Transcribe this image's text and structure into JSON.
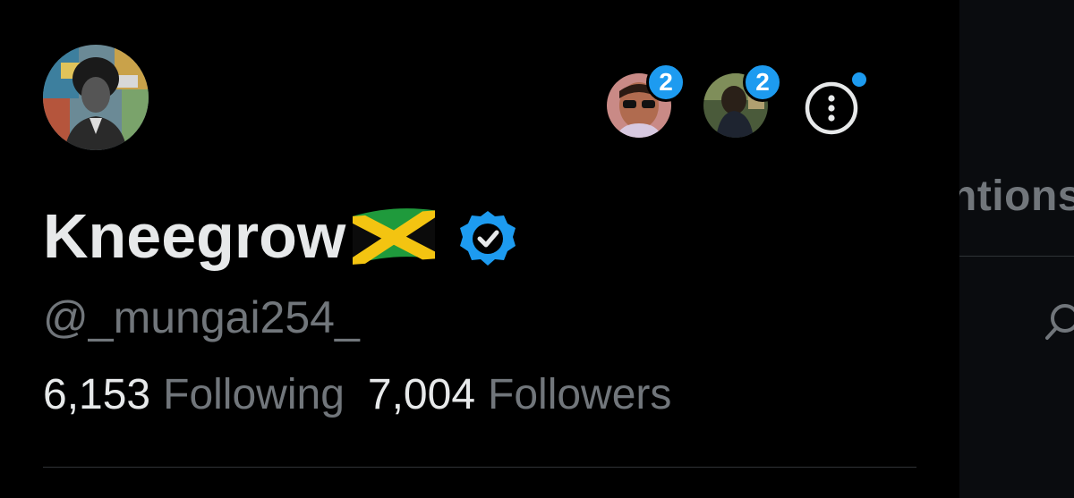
{
  "profile": {
    "display_name": "Kneegrow",
    "handle": "@_mungai254_",
    "following_count": "6,153",
    "following_label": "Following",
    "followers_count": "7,004",
    "followers_label": "Followers",
    "flag_emoji": "jamaica-flag-icon",
    "verified": "verified-badge-icon"
  },
  "accounts": [
    {
      "badge": "2"
    },
    {
      "badge": "2"
    }
  ],
  "background_panel": {
    "tab_label_fragment": "ntions"
  },
  "colors": {
    "background": "#000000",
    "text_primary": "#e7e9ea",
    "text_secondary": "#71767b",
    "accent": "#1d9bf0",
    "divider": "#2f3336"
  }
}
